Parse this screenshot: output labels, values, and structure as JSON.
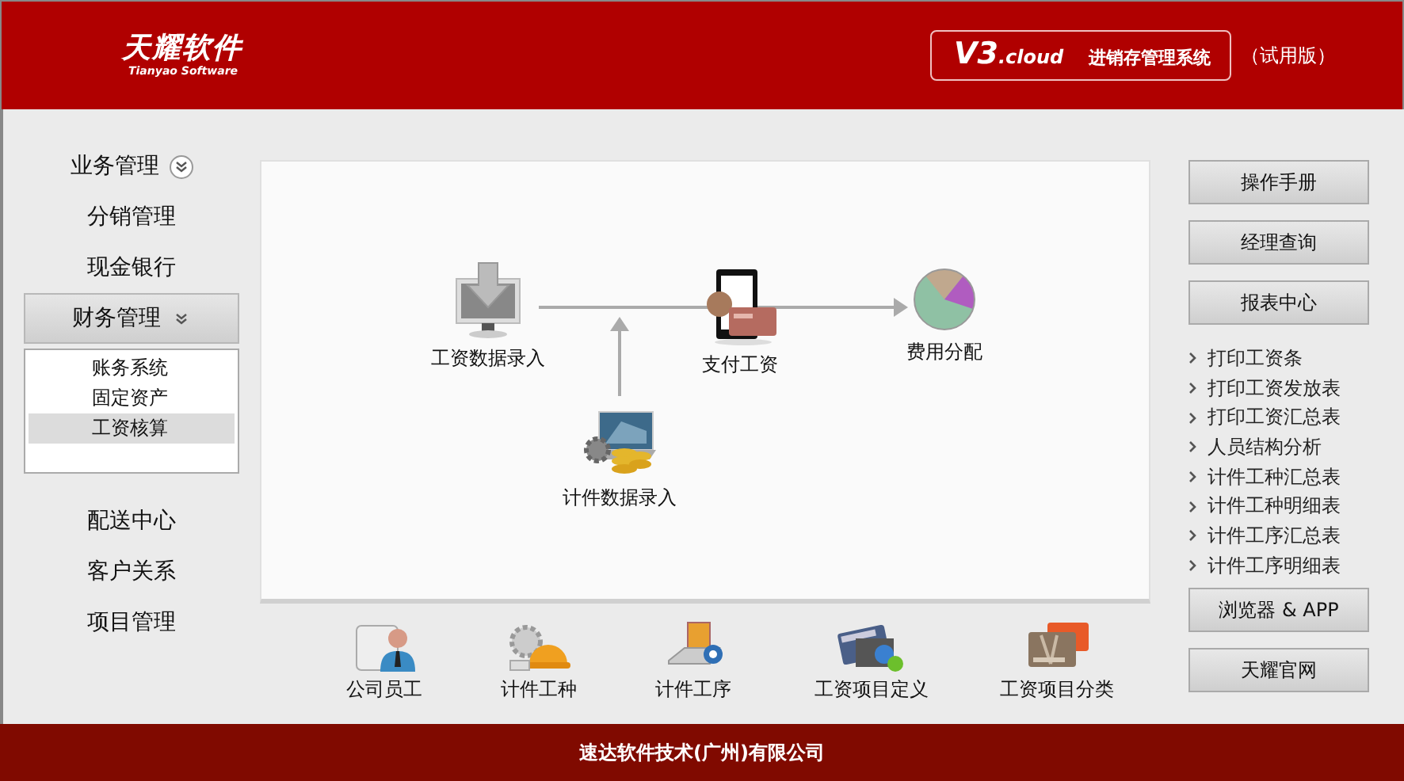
{
  "header": {
    "logo": "天耀软件",
    "logo_subtitle": "Tianyao Software",
    "version": "V3",
    "edition": ".cloud",
    "product": "进销存管理系统",
    "trial": "（试用版）"
  },
  "sidebar": {
    "items": [
      {
        "label": "业务管理",
        "kind": "group",
        "expanded": false
      },
      {
        "label": "分销管理",
        "kind": "link"
      },
      {
        "label": "现金银行",
        "kind": "link"
      },
      {
        "label": "财务管理",
        "kind": "group",
        "expanded": true,
        "children": [
          {
            "label": "账务系统",
            "selected": false
          },
          {
            "label": "固定资产",
            "selected": false
          },
          {
            "label": "工资核算",
            "selected": true
          }
        ]
      },
      {
        "label": "配送中心",
        "kind": "link"
      },
      {
        "label": "客户关系",
        "kind": "link"
      },
      {
        "label": "项目管理",
        "kind": "link"
      }
    ]
  },
  "workflow": {
    "nodes": [
      {
        "label": "工资数据录入",
        "kind": "monitor"
      },
      {
        "label": "支付工资",
        "kind": "payment"
      },
      {
        "label": "费用分配",
        "kind": "pie"
      },
      {
        "label": "计件数据录入",
        "kind": "coins"
      }
    ]
  },
  "shortcuts": [
    {
      "label": "公司员工",
      "kind": "employee"
    },
    {
      "label": "计件工种",
      "kind": "helmet"
    },
    {
      "label": "计件工序",
      "kind": "process"
    },
    {
      "label": "工资项目定义",
      "kind": "cards-gear"
    },
    {
      "label": "工资项目分类",
      "kind": "cards"
    }
  ],
  "right_panel": {
    "top_buttons": [
      "操作手册",
      "经理查询",
      "报表中心"
    ],
    "reports": [
      "打印工资条",
      "打印工资发放表",
      "打印工资汇总表",
      "人员结构分析",
      "计件工种汇总表",
      "计件工种明细表",
      "计件工序汇总表",
      "计件工序明细表"
    ],
    "bottom_buttons": [
      "浏览器 & APP",
      "天耀官网"
    ]
  },
  "footer": "速达软件技术(广州)有限公司"
}
